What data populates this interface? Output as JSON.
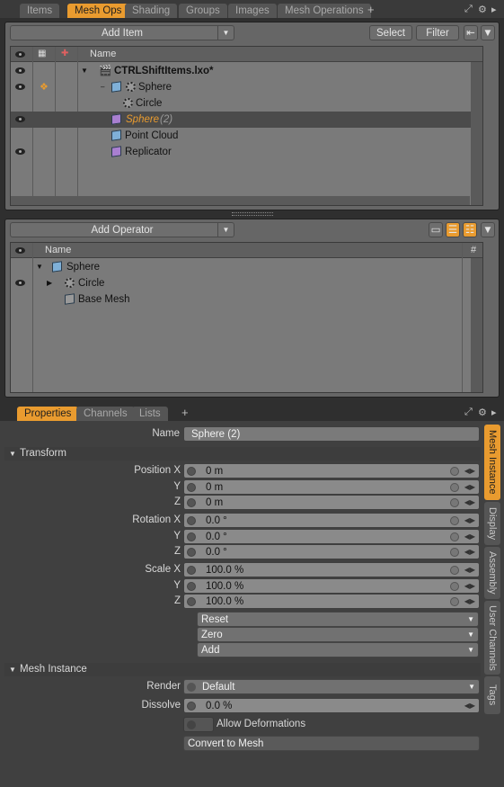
{
  "top_tabs": [
    "Items",
    "Mesh Ops",
    "Shading",
    "Groups",
    "Images",
    "Mesh Operations"
  ],
  "tab_add": "+",
  "item_panel": {
    "add_item": "Add Item",
    "select": "Select",
    "filter": "Filter",
    "name_header": "Name",
    "rows": [
      {
        "label": "CTRLShiftItems.lxo*"
      },
      {
        "label": "Sphere"
      },
      {
        "label": "Circle"
      },
      {
        "label": "Sphere",
        "suffix": "(2)"
      },
      {
        "label": "Point Cloud"
      },
      {
        "label": "Replicator"
      }
    ]
  },
  "op_panel": {
    "add_operator": "Add Operator",
    "name_header": "Name",
    "hash_header": "#",
    "rows": [
      {
        "label": "Sphere"
      },
      {
        "label": "Circle"
      },
      {
        "label": "Base Mesh"
      }
    ]
  },
  "prop_tabs": [
    "Properties",
    "Channels",
    "Lists"
  ],
  "properties": {
    "name_label": "Name",
    "name_value": "Sphere (2)",
    "transform": "Transform",
    "position_label": "Position X",
    "y": "Y",
    "z": "Z",
    "pos": [
      "0 m",
      "0 m",
      "0 m"
    ],
    "rotation_label": "Rotation X",
    "rot": [
      "0.0 °",
      "0.0 °",
      "0.0 °"
    ],
    "scale_label": "Scale X",
    "scl": [
      "100.0 %",
      "100.0 %",
      "100.0 %"
    ],
    "reset": "Reset",
    "zero": "Zero",
    "add": "Add",
    "mesh_instance": "Mesh Instance",
    "render_label": "Render",
    "render_value": "Default",
    "dissolve_label": "Dissolve",
    "dissolve_value": "0.0 %",
    "allow_deformations": "Allow Deformations",
    "convert": "Convert to Mesh"
  },
  "side_tabs": [
    "Mesh Instance",
    "Display",
    "Assembly",
    "User Channels",
    "Tags"
  ],
  "accent": "#e99b2f"
}
